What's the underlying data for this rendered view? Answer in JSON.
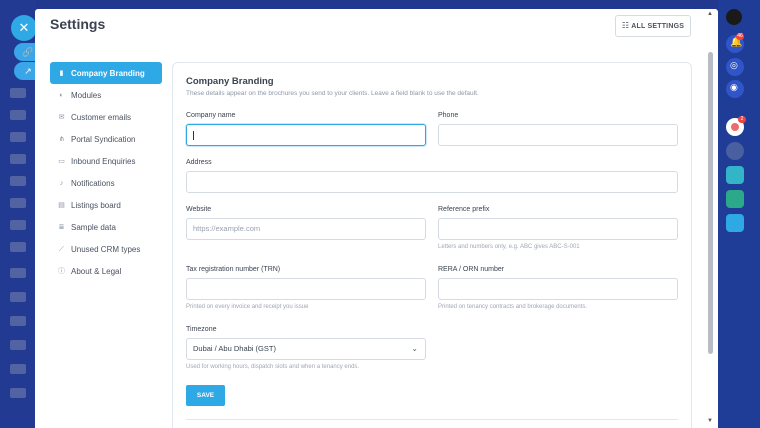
{
  "panel": {
    "title": "Settings",
    "all_settings_label": "ALL SETTINGS"
  },
  "sidebar": {
    "items": [
      {
        "label": "Company Branding",
        "icon": "building-icon",
        "active": true
      },
      {
        "label": "Modules",
        "icon": "toggle-icon",
        "active": false
      },
      {
        "label": "Customer emails",
        "icon": "mail-icon",
        "active": false
      },
      {
        "label": "Portal Syndication",
        "icon": "share-icon",
        "active": false
      },
      {
        "label": "Inbound Enquiries",
        "icon": "inbox-icon",
        "active": false
      },
      {
        "label": "Notifications",
        "icon": "bell-icon",
        "active": false
      },
      {
        "label": "Listings board",
        "icon": "board-icon",
        "active": false
      },
      {
        "label": "Sample data",
        "icon": "database-icon",
        "active": false
      },
      {
        "label": "Unused CRM types",
        "icon": "broom-icon",
        "active": false
      },
      {
        "label": "About & Legal",
        "icon": "info-icon",
        "active": false
      }
    ]
  },
  "form": {
    "title": "Company Branding",
    "subtitle": "These details appear on the brochures you send to your clients. Leave a field blank to use the default.",
    "company_name": {
      "label": "Company name",
      "value": ""
    },
    "phone": {
      "label": "Phone",
      "value": ""
    },
    "address": {
      "label": "Address",
      "value": ""
    },
    "website": {
      "label": "Website",
      "placeholder": "https://example.com"
    },
    "reference_prefix": {
      "label": "Reference prefix",
      "hint": "Letters and numbers only, e.g. ABC gives ABC-S-001"
    },
    "trn": {
      "label": "Tax registration number (TRN)",
      "hint": "Printed on every invoice and receipt you issue"
    },
    "rera": {
      "label": "RERA / ORN number",
      "hint": "Printed on tenancy contracts and brokerage documents."
    },
    "timezone": {
      "label": "Timezone",
      "value": "Dubai / Abu Dhabi (GST)",
      "hint": "Used for working hours, dispatch slots and when a tenancy ends."
    },
    "save_label": "SAVE"
  },
  "rail": {
    "badge_count": "46",
    "badge2": "2"
  },
  "colors": {
    "accent": "#2fa8e6",
    "text": "#3b4350",
    "muted": "#8f97a5",
    "border": "#d6dbe3"
  }
}
